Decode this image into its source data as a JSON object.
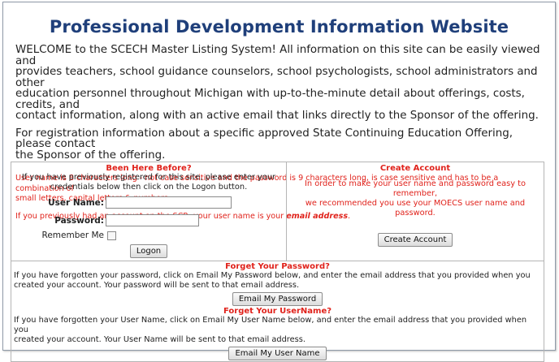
{
  "page": {
    "title": "Professional Development Information Website",
    "intro_lines": [
      "WELCOME to the SCECH Master Listing System! All information on this site can be easily viewed and",
      "provides teachers, school guidance counselors, school psychologists, school administrators and other",
      "education personnel throughout Michigan with up-to-the-minute detail about offerings, costs, credits, and",
      "contact information, along with an active email that links directly to the Sponsor of the offering."
    ],
    "intro2_lines": [
      "For registration information about a specific approved State Continuing Education Offering, please contact",
      "the Sponsor of the offering."
    ],
    "warning_lines": [
      "User name is 8 characters long - not case sensitive and the password is 9 characters long, is case sensitive and has to be a combination of",
      "small letters, capital letters & numbers."
    ],
    "warning2_text": "If you previously had an account on the SCR, your user name is your ",
    "warning2_emph": "email address",
    "warning2_end": "."
  },
  "login": {
    "heading": "Been Here Before?",
    "instructions_lines": [
      "If you have previously registered for this site, please enter your",
      "credentials below then click on the Logon button."
    ],
    "username_label": "User Name:",
    "username_value": "",
    "password_label": "Password:",
    "password_value": "",
    "remember_label": "Remember Me",
    "logon_button": "Logon"
  },
  "create_account": {
    "heading": "Create Account",
    "text_lines": [
      "In order to make your user name and password easy to remember,",
      "we recommended you use your MOECS user name and password."
    ],
    "button": "Create Account"
  },
  "forgot_password": {
    "heading": "Forget Your Password?",
    "text_lines": [
      "If you have forgotten your password, click on Email My Password below, and enter the email address that you provided when you",
      "created your account. Your password will be sent to that email address."
    ],
    "button": "Email My Password"
  },
  "forgot_username": {
    "heading": "Forget Your UserName?",
    "text_lines": [
      "If you have forgotten your User Name, click on Email My User Name below, and enter the email address that you provided when you",
      "created your account. Your User Name will be sent to that email address."
    ],
    "button": "Email My User Name"
  },
  "colors": {
    "title": "#1f3f7a",
    "warning": "#e0221b",
    "border": "#b5b5b5"
  }
}
